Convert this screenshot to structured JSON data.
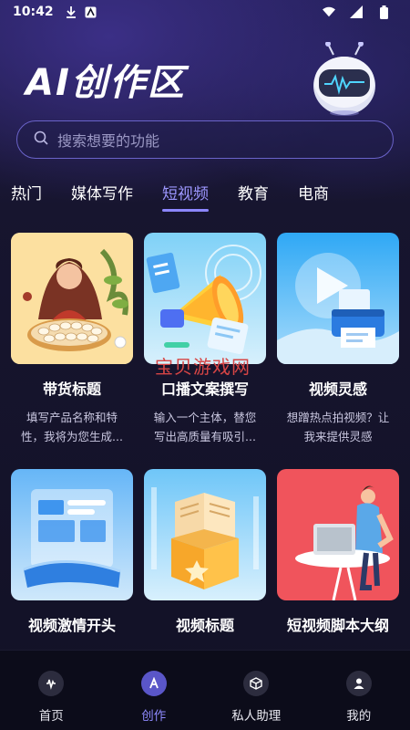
{
  "status_bar": {
    "time": "10:42"
  },
  "header": {
    "title": "AI创作区"
  },
  "search": {
    "placeholder": "搜索想要的功能"
  },
  "tabs": [
    {
      "label": "热门",
      "active": false
    },
    {
      "label": "媒体写作",
      "active": false
    },
    {
      "label": "短视频",
      "active": true
    },
    {
      "label": "教育",
      "active": false
    },
    {
      "label": "电商",
      "active": false
    }
  ],
  "cards": [
    {
      "title": "带货标题",
      "desc": "填写产品名称和特性，我将为您生成..."
    },
    {
      "title": "口播文案撰写",
      "desc": "输入一个主体，替您写出高质量有吸引..."
    },
    {
      "title": "视频灵感",
      "desc": "想蹭热点拍视频？让我来提供灵感"
    },
    {
      "title": "视频激情开头",
      "desc": ""
    },
    {
      "title": "视频标题",
      "desc": ""
    },
    {
      "title": "短视频脚本大纲",
      "desc": ""
    }
  ],
  "watermark": "宝贝游戏网",
  "bottom_nav": [
    {
      "label": "首页",
      "icon": "home-icon",
      "active": false
    },
    {
      "label": "创作",
      "icon": "create-icon",
      "active": true
    },
    {
      "label": "私人助理",
      "icon": "assistant-icon",
      "active": false
    },
    {
      "label": "我的",
      "icon": "profile-icon",
      "active": false
    }
  ],
  "colors": {
    "accent": "#8c86ff",
    "background": "#13122a",
    "nav_bg": "#0c0c1a"
  }
}
